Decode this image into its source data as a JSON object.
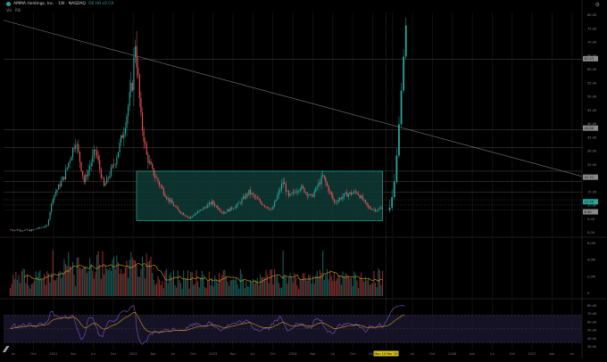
{
  "header": {
    "symbol": "AMMA Holdings, Inc. · 1W · NASDAQ",
    "ohlc": "O0 H0 L0 C0",
    "indicator_labels": [
      "Vol",
      "RSI"
    ],
    "settings_icon": "gear-icon"
  },
  "colors": {
    "up": "#26a69a",
    "down": "#ef5350",
    "box_fill": "#0f3b36",
    "box_stroke": "#2aa898",
    "rsi_band": "#1b1630",
    "rsi_line": "#7e57c2",
    "rsi_ma": "#d4a017",
    "vol_ma": "#d4a017"
  },
  "price_axis": {
    "labels": [
      "80.00",
      "75.00",
      "70.00",
      "65.00",
      "60.00",
      "55.00",
      "50.00",
      "45.00",
      "40.00",
      "35.00",
      "30.00",
      "25.00",
      "20.00",
      "15.00",
      "10.00",
      "5.00",
      "0.00"
    ]
  },
  "volume_axis": {
    "labels": [
      "6.0M",
      "4.0M",
      "2.0M",
      "0"
    ]
  },
  "rsi_axis": {
    "labels": [
      "80.00",
      "70.00",
      "60.00",
      "50.00",
      "40.00",
      "30.00"
    ]
  },
  "time_axis": {
    "labels": [
      "Jul",
      "Oct",
      "2021",
      "Apr",
      "Jul",
      "Oct",
      "2022",
      "Apr",
      "Jul",
      "Oct",
      "2023",
      "Apr",
      "Jul",
      "Oct",
      "2024",
      "Apr",
      "Jul",
      "Oct",
      "2025",
      "Apr",
      "Jul",
      "Oct",
      "2026",
      "Apr",
      "Jul",
      "Oct",
      "2027",
      "Apr",
      "Jul"
    ],
    "highlight": "Mon 10 Mar '25"
  },
  "chart_data": {
    "type": "candlestick",
    "xlabel": "",
    "ylabel": "",
    "x_range": [
      "2020-06",
      "2027-09"
    ],
    "ylim": [
      0,
      85
    ],
    "consolidation_box": {
      "x_start": "2022-02",
      "x_end": "2025-03",
      "y_low": 5,
      "y_high": 24
    },
    "trendline": {
      "from": [
        "2020-06",
        82
      ],
      "to": [
        "2027-09",
        22
      ]
    },
    "horizontal_levels": [
      67,
      40,
      33,
      24,
      20,
      16,
      13,
      11,
      9
    ],
    "price_labels_right": [
      {
        "value": "67.23",
        "color": "#888"
      },
      {
        "value": "40.56",
        "color": "#888"
      },
      {
        "value": "21.70",
        "color": "#888"
      },
      {
        "value": "12.26",
        "color": "#26a69a"
      },
      {
        "value": "8.40",
        "color": "#888"
      }
    ],
    "volume_ma_note": "20-week average",
    "rsi_period": 14,
    "rsi_band": [
      30,
      70
    ]
  }
}
